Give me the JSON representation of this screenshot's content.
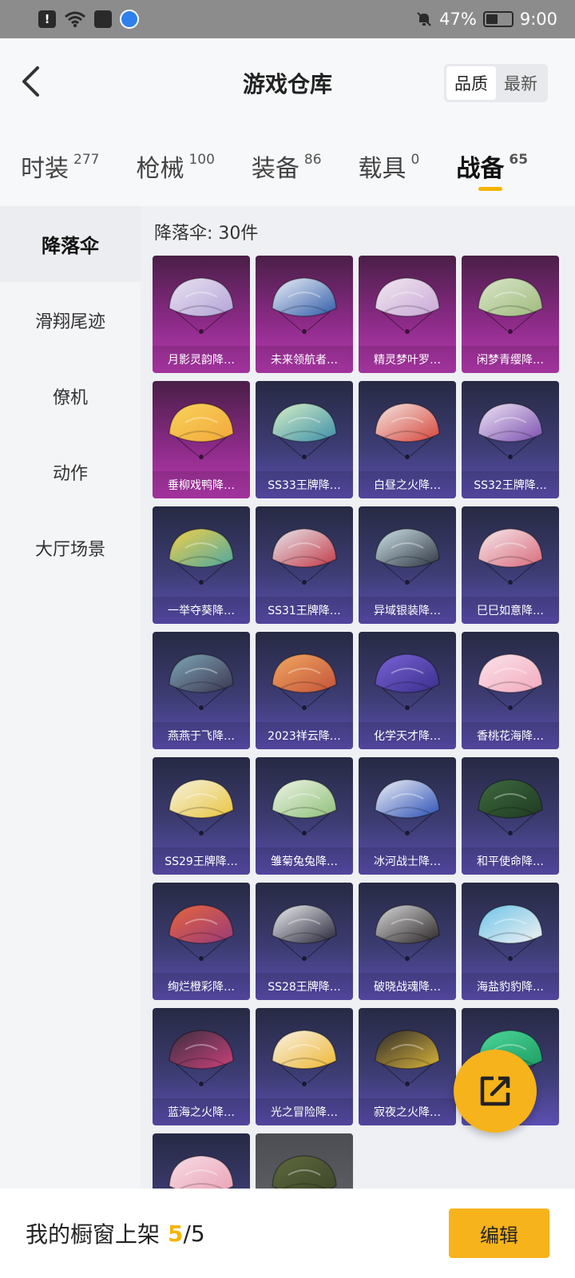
{
  "status_bar": {
    "battery": "47%",
    "time": "9:00",
    "battery_level": 0.47
  },
  "header": {
    "title": "游戏仓库",
    "sort_options": [
      "品质",
      "最新"
    ],
    "sort_selected": "品质"
  },
  "tabs": [
    {
      "label": "时装",
      "count": "277"
    },
    {
      "label": "枪械",
      "count": "100"
    },
    {
      "label": "装备",
      "count": "86"
    },
    {
      "label": "载具",
      "count": "0"
    },
    {
      "label": "战备",
      "count": "65",
      "active": true
    }
  ],
  "sidebar": {
    "items": [
      "降落伞",
      "滑翔尾迹",
      "僚机",
      "动作",
      "大厅场景"
    ],
    "selected": "降落伞"
  },
  "content": {
    "count_label": "降落伞: 30件",
    "items": [
      {
        "name": "月影灵韵降…",
        "rarity": "purple",
        "colors": [
          "#e9e3ef",
          "#b3a3d9"
        ]
      },
      {
        "name": "未来领航者…",
        "rarity": "purple",
        "colors": [
          "#eef2f7",
          "#2f5aa8"
        ]
      },
      {
        "name": "精灵梦叶罗…",
        "rarity": "purple",
        "colors": [
          "#f1e9ef",
          "#c9a7d7"
        ]
      },
      {
        "name": "闲梦青缨降…",
        "rarity": "purple",
        "colors": [
          "#d9e7c9",
          "#9fba7d"
        ]
      },
      {
        "name": "垂柳戏鸭降…",
        "rarity": "purple",
        "colors": [
          "#f9d25b",
          "#f2a93b"
        ]
      },
      {
        "name": "SS33王牌降…",
        "rarity": "blue",
        "colors": [
          "#d7f0c8",
          "#3d8fa8"
        ]
      },
      {
        "name": "白昼之火降…",
        "rarity": "blue",
        "colors": [
          "#f4e7e1",
          "#d6453c"
        ]
      },
      {
        "name": "SS32王牌降…",
        "rarity": "blue",
        "colors": [
          "#efe6f5",
          "#7b4fb0"
        ]
      },
      {
        "name": "一举夺葵降…",
        "rarity": "blue",
        "colors": [
          "#f3d048",
          "#4da8a1"
        ]
      },
      {
        "name": "SS31王牌降…",
        "rarity": "blue",
        "colors": [
          "#e8e8ee",
          "#c23a47"
        ]
      },
      {
        "name": "异域银装降…",
        "rarity": "blue",
        "colors": [
          "#cfe5ea",
          "#2e3440"
        ]
      },
      {
        "name": "巳巳如意降…",
        "rarity": "blue",
        "colors": [
          "#f5e9ec",
          "#d96a7b"
        ]
      },
      {
        "name": "燕燕于飞降…",
        "rarity": "blue",
        "colors": [
          "#7fa8b8",
          "#3b3550"
        ]
      },
      {
        "name": "2023祥云降…",
        "rarity": "blue",
        "colors": [
          "#f0a860",
          "#c4533a"
        ]
      },
      {
        "name": "化学天才降…",
        "rarity": "blue",
        "colors": [
          "#7a63d6",
          "#3a2f8c"
        ]
      },
      {
        "name": "香桃花海降…",
        "rarity": "blue",
        "colors": [
          "#fbe3ea",
          "#f2a9bd"
        ]
      },
      {
        "name": "SS29王牌降…",
        "rarity": "blue",
        "colors": [
          "#f6f3df",
          "#e9c441"
        ]
      },
      {
        "name": "雏菊兔兔降…",
        "rarity": "blue",
        "colors": [
          "#eef4e6",
          "#8fc07a"
        ]
      },
      {
        "name": "冰河战士降…",
        "rarity": "blue",
        "colors": [
          "#f1f3f8",
          "#2b4fb5"
        ]
      },
      {
        "name": "和平使命降…",
        "rarity": "blue",
        "colors": [
          "#3e6a3f",
          "#1f3a22"
        ]
      },
      {
        "name": "绚烂橙彩降…",
        "rarity": "blue",
        "colors": [
          "#e5663c",
          "#9a3a7a"
        ]
      },
      {
        "name": "SS28王牌降…",
        "rarity": "blue",
        "colors": [
          "#f1f1f4",
          "#232336"
        ]
      },
      {
        "name": "破晓战魂降…",
        "rarity": "blue",
        "colors": [
          "#d9d9d9",
          "#2a2526"
        ]
      },
      {
        "name": "海盐豹豹降…",
        "rarity": "blue",
        "colors": [
          "#6cc3e8",
          "#f2f2f2"
        ]
      },
      {
        "name": "蓝海之火降…",
        "rarity": "blue",
        "colors": [
          "#3a2f3f",
          "#c9417a"
        ]
      },
      {
        "name": "光之冒险降…",
        "rarity": "blue",
        "colors": [
          "#f7f2e6",
          "#f0b733"
        ]
      },
      {
        "name": "寂夜之火降…",
        "rarity": "blue",
        "colors": [
          "#2e2a2c",
          "#d9b43a"
        ]
      },
      {
        "name": "",
        "rarity": "blue",
        "colors": [
          "#4dd79a",
          "#1e9e63"
        ]
      },
      {
        "name": "",
        "rarity": "blue",
        "colors": [
          "#f7dde6",
          "#e9a1b5"
        ]
      },
      {
        "name": "",
        "rarity": "gray",
        "colors": [
          "#5f6a3f",
          "#3c4428"
        ]
      }
    ]
  },
  "fab": {
    "icon": "share-icon"
  },
  "bottom_bar": {
    "label": "我的橱窗上架",
    "count": "5",
    "total": "/5",
    "edit_label": "编辑"
  }
}
